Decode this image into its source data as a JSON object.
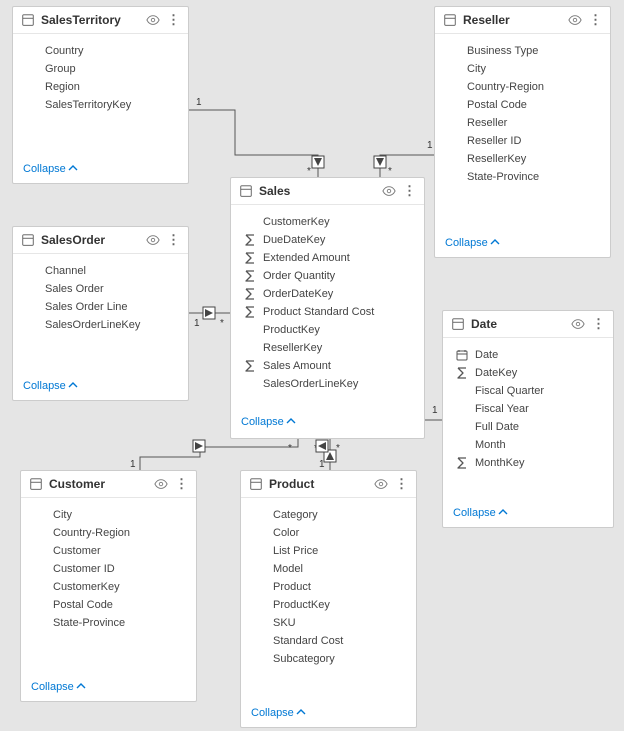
{
  "ui": {
    "collapseLabel": "Collapse"
  },
  "relationships": [
    {
      "from": "SalesTerritory",
      "to": "Sales",
      "cardFrom": "1",
      "cardTo": "*"
    },
    {
      "from": "Reseller",
      "to": "Sales",
      "cardFrom": "1",
      "cardTo": "*"
    },
    {
      "from": "SalesOrder",
      "to": "Sales",
      "cardFrom": "1",
      "cardTo": "*"
    },
    {
      "from": "Customer",
      "to": "Sales",
      "cardFrom": "1",
      "cardTo": "*"
    },
    {
      "from": "Date",
      "to": "Sales",
      "cardFrom": "1",
      "cardTo": "*"
    },
    {
      "from": "Product",
      "to": "Sales",
      "cardFrom": "1",
      "cardTo": "*"
    }
  ],
  "tables": {
    "salesTerritory": {
      "name": "SalesTerritory",
      "fields": [
        {
          "label": "Country"
        },
        {
          "label": "Group"
        },
        {
          "label": "Region"
        },
        {
          "label": "SalesTerritoryKey"
        }
      ]
    },
    "reseller": {
      "name": "Reseller",
      "fields": [
        {
          "label": "Business Type"
        },
        {
          "label": "City"
        },
        {
          "label": "Country-Region"
        },
        {
          "label": "Postal Code"
        },
        {
          "label": "Reseller"
        },
        {
          "label": "Reseller ID"
        },
        {
          "label": "ResellerKey"
        },
        {
          "label": "State-Province"
        }
      ]
    },
    "sales": {
      "name": "Sales",
      "fields": [
        {
          "label": "CustomerKey"
        },
        {
          "label": "DueDateKey",
          "icon": "sigma"
        },
        {
          "label": "Extended Amount",
          "icon": "sigma"
        },
        {
          "label": "Order Quantity",
          "icon": "sigma"
        },
        {
          "label": "OrderDateKey",
          "icon": "sigma"
        },
        {
          "label": "Product Standard Cost",
          "icon": "sigma"
        },
        {
          "label": "ProductKey"
        },
        {
          "label": "ResellerKey"
        },
        {
          "label": "Sales Amount",
          "icon": "sigma"
        },
        {
          "label": "SalesOrderLineKey"
        }
      ]
    },
    "salesOrder": {
      "name": "SalesOrder",
      "fields": [
        {
          "label": "Channel"
        },
        {
          "label": "Sales Order"
        },
        {
          "label": "Sales Order Line"
        },
        {
          "label": "SalesOrderLineKey"
        }
      ]
    },
    "customer": {
      "name": "Customer",
      "fields": [
        {
          "label": "City"
        },
        {
          "label": "Country-Region"
        },
        {
          "label": "Customer"
        },
        {
          "label": "Customer ID"
        },
        {
          "label": "CustomerKey"
        },
        {
          "label": "Postal Code"
        },
        {
          "label": "State-Province"
        }
      ]
    },
    "product": {
      "name": "Product",
      "fields": [
        {
          "label": "Category"
        },
        {
          "label": "Color"
        },
        {
          "label": "List Price"
        },
        {
          "label": "Model"
        },
        {
          "label": "Product"
        },
        {
          "label": "ProductKey"
        },
        {
          "label": "SKU"
        },
        {
          "label": "Standard Cost"
        },
        {
          "label": "Subcategory"
        }
      ]
    },
    "date": {
      "name": "Date",
      "fields": [
        {
          "label": "Date",
          "icon": "calendar"
        },
        {
          "label": "DateKey",
          "icon": "sigma"
        },
        {
          "label": "Fiscal Quarter"
        },
        {
          "label": "Fiscal Year"
        },
        {
          "label": "Full Date"
        },
        {
          "label": "Month"
        },
        {
          "label": "MonthKey",
          "icon": "sigma"
        }
      ]
    }
  }
}
